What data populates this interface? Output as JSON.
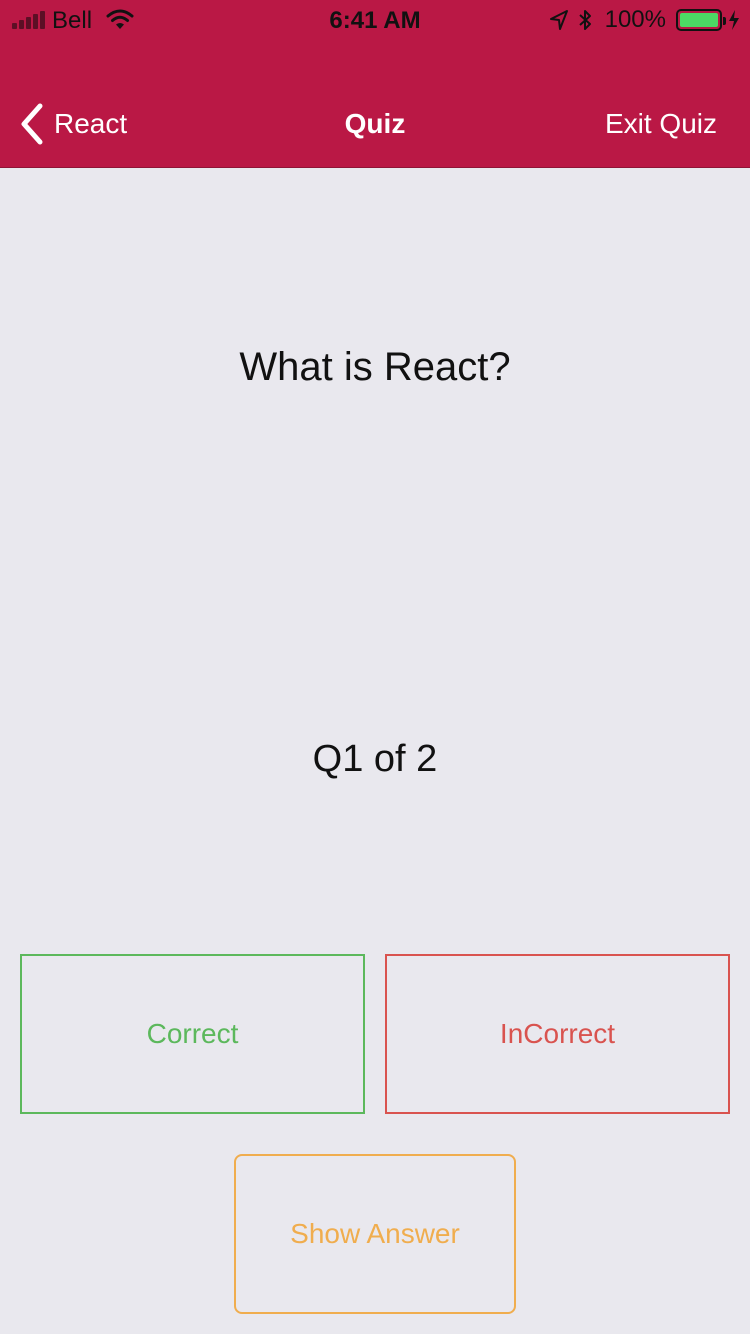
{
  "status_bar": {
    "carrier": "Bell",
    "time": "6:41 AM",
    "battery_percent": "100%",
    "battery_level": 1.0,
    "icons": [
      "signal-icon",
      "wifi-icon",
      "location-icon",
      "bluetooth-icon",
      "battery-icon",
      "charging-icon"
    ]
  },
  "nav": {
    "back_label": "React",
    "title": "Quiz",
    "exit_label": "Exit Quiz",
    "icons": [
      "chevron-left-icon"
    ]
  },
  "quiz": {
    "question": "What is React?",
    "progress": "Q1 of 2",
    "correct_label": "Correct",
    "incorrect_label": "InCorrect",
    "show_answer_label": "Show Answer"
  },
  "colors": {
    "header": "#ba1845",
    "background": "#e9e8ee",
    "correct": "#5cb85c",
    "incorrect": "#d9534f",
    "show_answer": "#f0ad4e",
    "battery": "#4cd964"
  }
}
